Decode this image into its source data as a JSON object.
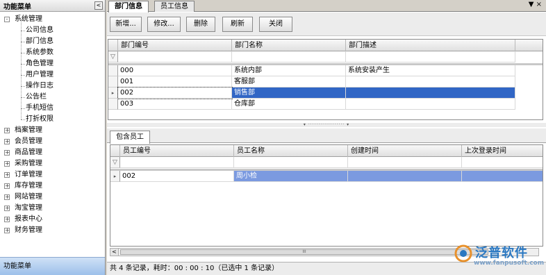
{
  "left_panel": {
    "title": "功能菜单",
    "collapse_glyph": "<",
    "footer": "功能菜单",
    "tree": [
      {
        "label": "系统管理",
        "expander": "-",
        "children": [
          "公司信息",
          "部门信息",
          "系统参数",
          "角色管理",
          "用户管理",
          "操作日志",
          "公告栏",
          "手机短信",
          "打折权限"
        ]
      },
      {
        "label": "档案管理",
        "expander": "+"
      },
      {
        "label": "会员管理",
        "expander": "+"
      },
      {
        "label": "商品管理",
        "expander": "+"
      },
      {
        "label": "采购管理",
        "expander": "+"
      },
      {
        "label": "订单管理",
        "expander": "+"
      },
      {
        "label": "库存管理",
        "expander": "+"
      },
      {
        "label": "网站管理",
        "expander": "+"
      },
      {
        "label": "淘宝管理",
        "expander": "+"
      },
      {
        "label": "报表中心",
        "expander": "+"
      },
      {
        "label": "财务管理",
        "expander": "+"
      }
    ]
  },
  "tabs": {
    "items": [
      "部门信息",
      "员工信息"
    ],
    "active": "部门信息",
    "controls": "▼ ×"
  },
  "toolbar": {
    "add": "新增...",
    "edit": "修改...",
    "delete": "删除",
    "refresh": "刷新",
    "close": "关闭"
  },
  "dept_grid": {
    "columns": [
      "部门编号",
      "部门名称",
      "部门描述"
    ],
    "filter_glyph": "▽",
    "rows": [
      {
        "code": "000",
        "name": "系统内部",
        "desc": "系统安装产生"
      },
      {
        "code": "001",
        "name": "客服部",
        "desc": ""
      },
      {
        "code": "002",
        "name": "销售部",
        "desc": "",
        "selected": true
      },
      {
        "code": "003",
        "name": "仓库部",
        "desc": ""
      }
    ]
  },
  "splitter_glyph": "▾ ·················· ▾",
  "sub_tabs": {
    "items": [
      "包含员工"
    ]
  },
  "emp_grid": {
    "columns": [
      "员工编号",
      "员工名称",
      "创建时间",
      "上次登录时间"
    ],
    "filter_glyph": "▽",
    "rows": [
      {
        "code": "002",
        "name": "周小检",
        "created": "",
        "last_login": "",
        "selected": true
      }
    ]
  },
  "scrollbar": {
    "left_arrow": "<",
    "thumb": "III"
  },
  "status": {
    "text": "共 4 条记录，耗时：00 : 00 : 10（已选中 1 条记录）"
  },
  "watermark": {
    "brand": "泛普软件",
    "url": "www.fanpusoft.com",
    "colors": {
      "brand": "#2a78c2",
      "url": "#7aa0c8"
    }
  },
  "colors": {
    "selection": "#3166c5",
    "selection_secondary": "#7b9ae0",
    "left_footer": "#9dc0ea"
  }
}
